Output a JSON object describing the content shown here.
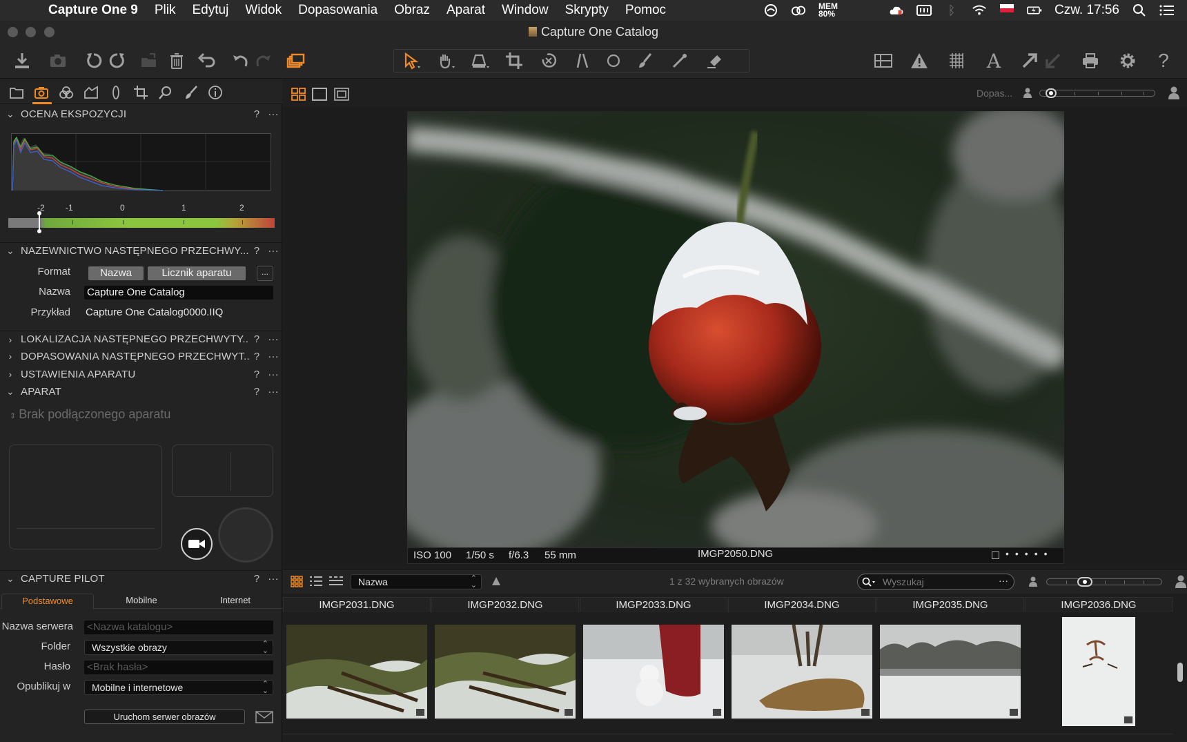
{
  "menubar": {
    "app_name": "Capture One 9",
    "items": [
      "Plik",
      "Edytuj",
      "Widok",
      "Dopasowania",
      "Obraz",
      "Aparat",
      "Window",
      "Skrypty",
      "Pomoc"
    ],
    "mem_label": "MEM",
    "mem_value": "80%",
    "clock": "Czw. 17:56"
  },
  "window": {
    "title": "Capture One Catalog"
  },
  "viewer_header": {
    "zoom_label": "Dopas..."
  },
  "exposure": {
    "title": "OCENA EKSPOZYCJI",
    "scale_labels": [
      "-2",
      "-1",
      "0",
      "1",
      "2"
    ],
    "exposure_value": -2,
    "scale_range": [
      -2.6,
      2.5
    ]
  },
  "naming": {
    "title": "NAZEWNICTWO NASTĘPNEGO PRZECHWY...",
    "format_label": "Format",
    "format_tokens": [
      "Nazwa",
      "Licznik aparatu"
    ],
    "more_label": "...",
    "name_label": "Nazwa",
    "name_value": "Capture One Catalog",
    "example_label": "Przykład",
    "example_value": "Capture One Catalog0000.IIQ"
  },
  "collapsed_sections": [
    "LOKALIZACJA NASTĘPNEGO PRZECHWYTY...",
    "DOPASOWANIA NASTĘPNEGO PRZECHWYT...",
    "USTAWIENIA APARATU"
  ],
  "camera": {
    "title": "APARAT",
    "no_camera": "Brak podłączonego aparatu"
  },
  "capture_pilot": {
    "title": "CAPTURE PILOT",
    "tabs": [
      "Podstawowe",
      "Mobilne",
      "Internet"
    ],
    "server_label": "Nazwa serwera",
    "server_placeholder": "<Nazwa katalogu>",
    "folder_label": "Folder",
    "folder_value": "Wszystkie obrazy",
    "password_label": "Hasło",
    "password_placeholder": "<Brak hasła>",
    "publish_label": "Opublikuj w",
    "publish_value": "Mobilne i internetowe",
    "start_button": "Uruchom serwer obrazów"
  },
  "photo": {
    "iso": "ISO 100",
    "shutter": "1/50 s",
    "aperture": "f/6.3",
    "focal": "55 mm",
    "filename": "IMGP2050.DNG"
  },
  "browser": {
    "sort_value": "Nazwa",
    "selection_count": "1 z 32 wybranych obrazów",
    "search_placeholder": "Wyszukaj",
    "thumbnails": [
      "IMGP2031.DNG",
      "IMGP2032.DNG",
      "IMGP2033.DNG",
      "IMGP2034.DNG",
      "IMGP2035.DNG",
      "IMGP2036.DNG"
    ]
  },
  "colors": {
    "accent": "#f08a24",
    "panel_bg": "#232323",
    "app_bg": "#1e1e1e"
  },
  "icons": {
    "toolbar_left": [
      "import-icon",
      "camera-icon",
      "rotate-left-icon",
      "rotate-right-icon",
      "folder-move-icon",
      "trash-icon",
      "undo-all-icon",
      "undo-icon",
      "redo-icon",
      "variants-icon"
    ],
    "toolbar_cursors": [
      "select-cursor-icon",
      "pan-icon",
      "loupe-icon",
      "crop-icon",
      "rotate-tool-icon",
      "keystone-icon",
      "spot-icon",
      "brush-icon",
      "picker-icon",
      "eraser-icon"
    ],
    "toolbar_right": [
      "grid-view-icon",
      "warning-icon",
      "focus-mask-icon",
      "text-icon",
      "export-icon",
      "export-disabled-icon",
      "print-icon",
      "settings-icon",
      "help-icon"
    ]
  }
}
